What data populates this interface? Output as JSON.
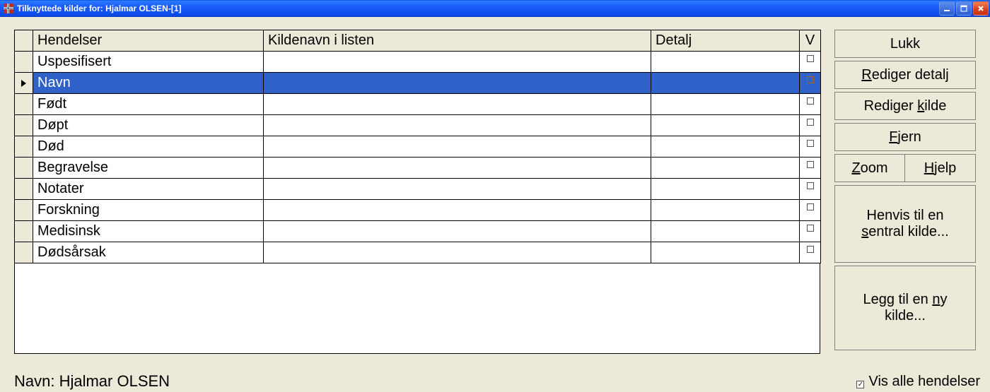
{
  "window": {
    "title": "Tilknyttede kilder for: Hjalmar OLSEN-[1]"
  },
  "grid": {
    "headers": {
      "event": "Hendelser",
      "source": "Kildenavn i listen",
      "detail": "Detalj",
      "v": "V"
    },
    "rows": [
      {
        "event": "Uspesifisert",
        "source": "",
        "detail": "",
        "v": false,
        "selected": false
      },
      {
        "event": "Navn",
        "source": "",
        "detail": "",
        "v": false,
        "selected": true
      },
      {
        "event": "Født",
        "source": "",
        "detail": "",
        "v": false,
        "selected": false
      },
      {
        "event": "Døpt",
        "source": "",
        "detail": "",
        "v": false,
        "selected": false
      },
      {
        "event": "Død",
        "source": "",
        "detail": "",
        "v": false,
        "selected": false
      },
      {
        "event": "Begravelse",
        "source": "",
        "detail": "",
        "v": false,
        "selected": false
      },
      {
        "event": "Notater",
        "source": "",
        "detail": "",
        "v": false,
        "selected": false
      },
      {
        "event": "Forskning",
        "source": "",
        "detail": "",
        "v": false,
        "selected": false
      },
      {
        "event": "Medisinsk",
        "source": "",
        "detail": "",
        "v": false,
        "selected": false
      },
      {
        "event": "Dødsårsak",
        "source": "",
        "detail": "",
        "v": false,
        "selected": false
      }
    ]
  },
  "buttons": {
    "close": {
      "text": "Lukk"
    },
    "edit_detail": {
      "pre": "",
      "u": "R",
      "post": "ediger detalj"
    },
    "edit_source": {
      "pre": "Rediger ",
      "u": "k",
      "post": "ilde"
    },
    "remove": {
      "pre": "",
      "u": "F",
      "post": "jern"
    },
    "zoom": {
      "pre": "",
      "u": "Z",
      "post": "oom"
    },
    "help": {
      "pre": "",
      "u": "H",
      "post": "jelp"
    },
    "refer_central": {
      "line1_pre": "Henvis til en",
      "line2_pre": "",
      "line2_u": "s",
      "line2_post": "entral kilde..."
    },
    "add_new": {
      "line1_pre": "Legg til en ",
      "line1_u": "n",
      "line1_post": "y",
      "line2": "kilde..."
    }
  },
  "footer": {
    "name_label": "Navn: Hjalmar OLSEN",
    "show_all_label": "Vis alle hendelser",
    "show_all_checked": true
  }
}
